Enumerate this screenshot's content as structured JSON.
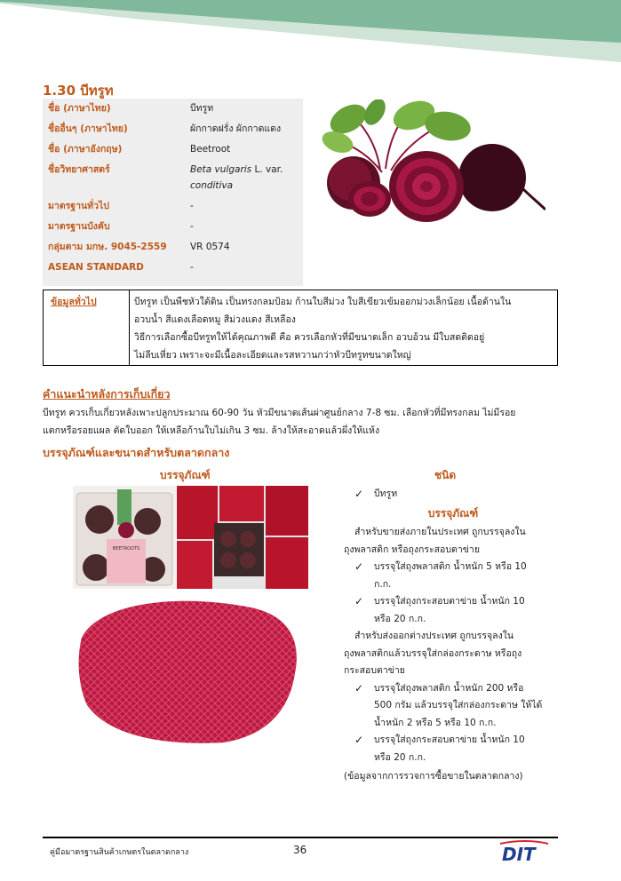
{
  "product": {
    "title": "1.30 บีทรูท",
    "rows": [
      {
        "key": "ชื่อ (ภาษาไทย)",
        "value": "บีทรูท"
      },
      {
        "key": "ชื่ออื่นๆ (ภาษาไทย)",
        "value": "ผักกาดฝรั่ง ผักกาดแดง"
      },
      {
        "key": "ชื่อ (ภาษาอังกฤษ)",
        "value": "Beetroot"
      },
      {
        "key": "ชื่อวิทยาศาสตร์",
        "value_italic1": "Beta vulgaris",
        "value_plain": " L. var.",
        "value_italic2": "conditiva"
      },
      {
        "key": "มาตรฐานทั่วไป",
        "value": "-"
      },
      {
        "key": "มาตรฐานบังคับ",
        "value": "-"
      },
      {
        "key": "กลุ่มตาม มกษ. 9045-2559",
        "value": "VR 0574"
      },
      {
        "key": "ASEAN STANDARD",
        "value": "-"
      }
    ]
  },
  "general": {
    "label": "ข้อมูลทั่วไป",
    "line1": "บีทรูท เป็นพืชหัวใต้ดิน เป็นทรงกลมป้อม ก้านใบสีม่วง ใบสีเขียวเข้มออกม่วงเล็กน้อย เนื้อด้านใน",
    "line2": "อวบน้ำ สีแดงเลือดหมู สีม่วงแดง สีเหลือง",
    "line3": "วิธีการเลือกซื้อบีทรูทให้ได้คุณภาพดี คือ ควรเลือกหัวที่มีขนาดเล็ก อวบอ้วน มีใบสดติดอยู่",
    "line4": "ไม่ลีบเหี่ยว เพราะจะมีเนื้อละเอียดและรสหวานกว่าหัวบีทรูทขนาดใหญ่"
  },
  "harvest": {
    "title": "คำแนะนำหลังการเก็บเกี่ยว",
    "line1": "บีทรูท ควรเก็บเกี่ยวหลังเพาะปลูกประมาณ 60-90 วัน หัวมีขนาดเส้นผ่าศูนย์กลาง 7-8 ซม. เลือกหัวที่มีทรงกลม ไม่มีรอย",
    "line2": "แตกหรือรอยแผล ตัดใบออก ให้เหลือก้านใบไม่เกิน 3 ซม. ล้างให้สะอาดแล้วผึ่งให้แห้ง"
  },
  "packaging": {
    "title": "บรรจุภัณฑ์และขนาดสำหรับตลาดกลาง",
    "col_left": "บรรจุภัณฑ์",
    "col_right": "ชนิด",
    "type_item": "บีทรูท",
    "sub_title": "บรรจุภัณฑ์",
    "domestic1": "สำหรับขายส่งภายในประเทศ ถูกบรรจุลงใน",
    "domestic2": "ถุงพลาสติก หรือถุงกระสอบตาข่าย",
    "dom_item1_a": "บรรจุใส่ถุงพลาสติก น้ำหนัก 5 หรือ 10",
    "dom_item1_b": "ก.ก.",
    "dom_item2_a": "บรรจุใส่ถุงกระสอบตาข่าย น้ำหนัก 10",
    "dom_item2_b": "หรือ 20 ก.ก.",
    "export1": "สำหรับส่งออกต่างประเทศ ถูกบรรจุลงใน",
    "export2": "ถุงพลาสติกแล้วบรรจุใส่กล่องกระดาษ หรือถุง",
    "export3": "กระสอบตาข่าย",
    "exp_item1_a": "บรรจุใส่ถุงพลาสติก น้ำหนัก 200 หรือ",
    "exp_item1_b": "500 กรัม แล้วบรรจุใส่กล่องกระดาษ ให้ได้",
    "exp_item1_c": "น้ำหนัก 2 หรือ 5 หรือ 10 ก.ก.",
    "exp_item2_a": "บรรจุใส่ถุงกระสอบตาข่าย น้ำหนัก 10",
    "exp_item2_b": "หรือ 20 ก.ก.",
    "source": "(ข้อมูลจากการรวจการซื้อขายในตลาดกลาง)",
    "bag_label": "BEETROOTS"
  },
  "footer": {
    "left": "คู่มือมาตรฐานสินค้าเกษตรในตลาดกลาง",
    "page": "36",
    "logo": "DIT"
  },
  "colors": {
    "accent": "#c05a1c",
    "header_green": "#7fb89a",
    "beet": "#7a1030"
  }
}
